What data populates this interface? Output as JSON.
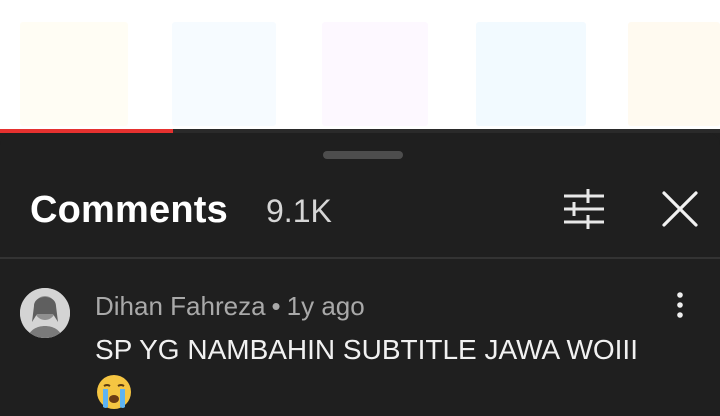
{
  "video": {
    "progress": 0.24,
    "progress_color": "#e5312f"
  },
  "comments_panel": {
    "title": "Comments",
    "count": "9.1K",
    "icons": {
      "filter": "sort-filter-icon",
      "close": "close-icon",
      "more": "more-vertical-icon",
      "drag": "drag-handle"
    },
    "comments": [
      {
        "author": "Dihan Fahreza",
        "separator": "•",
        "time": "1y ago",
        "text": "SP YG NAMBAHIN SUBTITLE JAWA WOIII",
        "emoji": "crying-face-emoji"
      }
    ]
  },
  "colors": {
    "background": "#1f1f1f",
    "accent": "#e5312f",
    "text_primary": "#ffffff",
    "text_secondary": "#a9a9a9"
  }
}
